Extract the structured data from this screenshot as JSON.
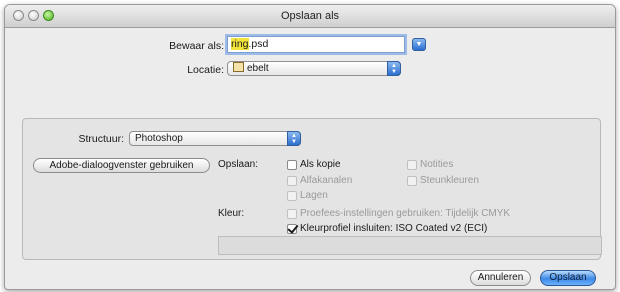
{
  "window": {
    "title": "Opslaan als"
  },
  "save_as": {
    "label": "Bewaar als:",
    "filename_selected": "ring",
    "filename_ext": ".psd"
  },
  "location": {
    "label": "Locatie:",
    "value": "ebelt"
  },
  "format": {
    "label": "Structuur:",
    "value": "Photoshop"
  },
  "adobe_dialog_button": "Adobe-dialoogvenster gebruiken",
  "save_options": {
    "label": "Opslaan:",
    "as_copy": "Als kopie",
    "alpha_channels": "Alfakanalen",
    "layers": "Lagen",
    "notes": "Notities",
    "spot_colors": "Steunkleuren"
  },
  "color": {
    "label": "Kleur:",
    "proof_setup": "Proefees-instellingen gebruiken: Tijdelijk CMYK",
    "embed_profile": "Kleurprofiel insluiten: ISO Coated v2 (ECI)"
  },
  "buttons": {
    "cancel": "Annuleren",
    "save": "Opslaan"
  },
  "colors": {
    "accent": "#3e8ae6",
    "selection_highlight": "#f2e43a",
    "focus_ring": "#9dbbe8"
  }
}
